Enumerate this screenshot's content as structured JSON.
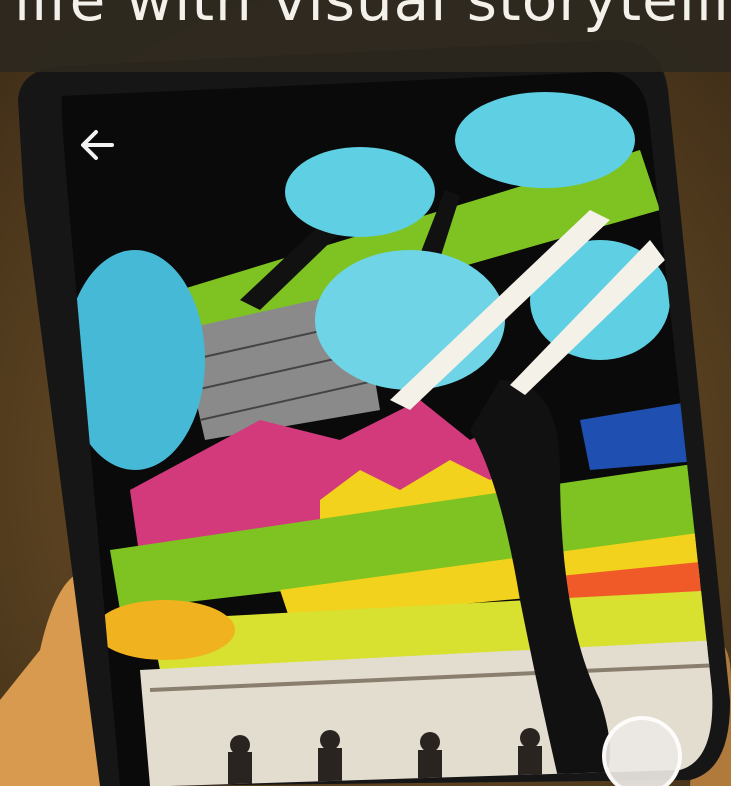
{
  "banner": {
    "caption": "life with visual storytelling"
  },
  "ar_view": {
    "back_icon": "arrow-left-icon",
    "shutter_icon": "circle-shutter-icon"
  },
  "colors": {
    "wall": "#5a4526",
    "cloud": "#5fcfe3",
    "stripe_green": "#7ec322",
    "stripe_yellow": "#f2d21c",
    "stripe_magenta": "#d23a7c",
    "ar_sky": "#0a0a0a"
  }
}
